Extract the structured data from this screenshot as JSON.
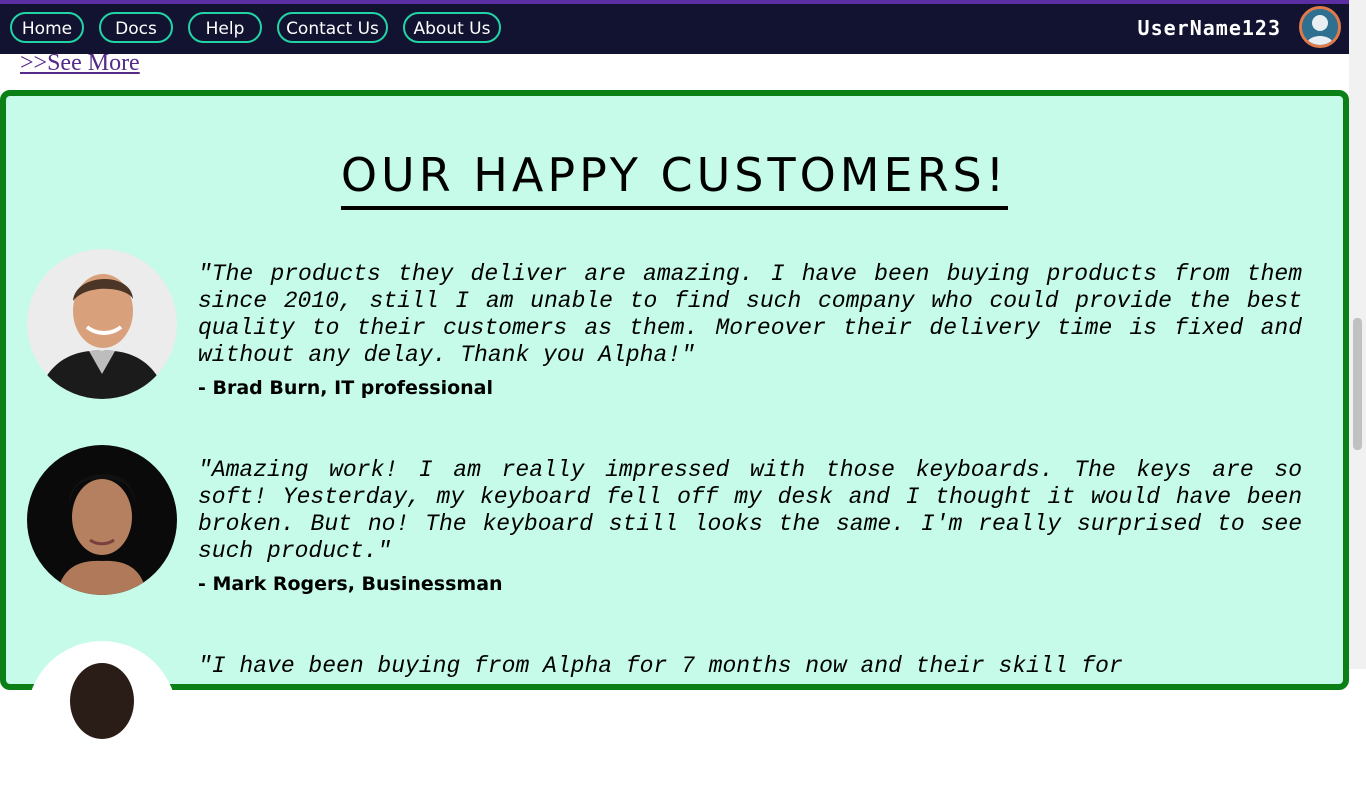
{
  "nav": {
    "items": [
      "Home",
      "Docs",
      "Help",
      "Contact Us",
      "About Us"
    ],
    "username": "UserName123"
  },
  "see_more": ">>See More",
  "testimonials_section": {
    "title": "OUR HAPPY CUSTOMERS!",
    "items": [
      {
        "quote": "\"The products they deliver are amazing. I have been buying products from them since 2010, still I am unable to find such company who could provide the best quality to their customers as them. Moreover their delivery time is fixed and without any delay. Thank you Alpha!\"",
        "author": "- Brad Burn, IT professional"
      },
      {
        "quote": "\"Amazing work! I am really impressed with those keyboards. The keys are so soft! Yesterday, my keyboard fell off my desk and I thought it would have been broken. But no! The keyboard still looks the same. I'm really surprised to see such product.\"",
        "author": "- Mark Rogers, Businessman"
      },
      {
        "quote": "\"I have been buying from Alpha for 7 months now and their skill for",
        "author": ""
      }
    ]
  },
  "colors": {
    "navbar_bg": "#121330",
    "nav_border": "#22d3a6",
    "panel_bg": "#c5fbe8",
    "panel_border": "#0b8016",
    "link": "#552a88"
  }
}
